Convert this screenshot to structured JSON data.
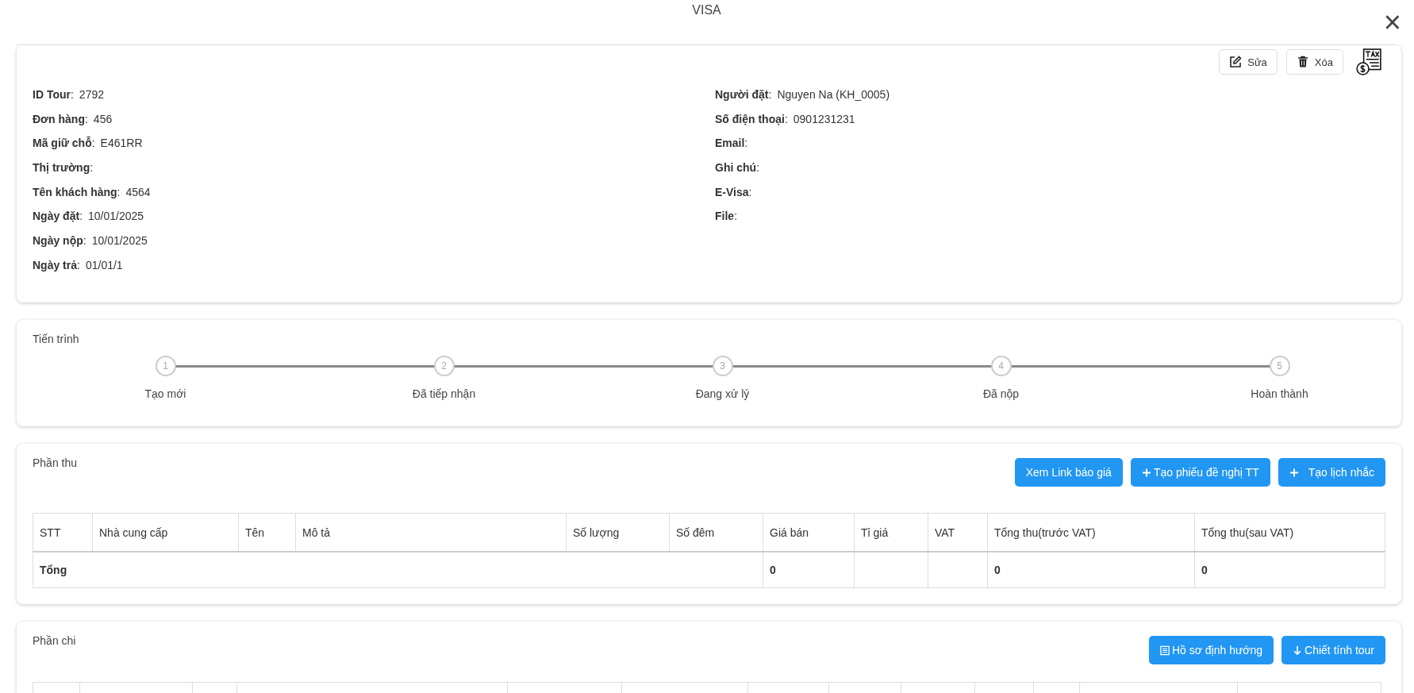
{
  "dialog": {
    "title": "VISA",
    "close": "×"
  },
  "info": {
    "actions": [
      {
        "kind": "edit",
        "label": "Sửa"
      },
      {
        "kind": "delete",
        "label": "Xóa"
      }
    ],
    "left": [
      {
        "label": "**ID Tour**:",
        "value": "2792"
      },
      {
        "label": "**Đơn hàng**:",
        "value": "456"
      },
      {
        "label": "**Mã giữ chỗ**:",
        "value": "E461RR"
      },
      {
        "label": "**Thị trường**:"
      },
      {
        "label": "**Tên khách hàng**:",
        "value": "4564"
      },
      {
        "label": "**Ngày đặt**:",
        "value": "10/01/2025"
      },
      {
        "label": "**Ngày nộp**:",
        "value": "10/01/2025"
      },
      {
        "label": "**Ngày trả**:",
        "value": "01/01/1"
      }
    ],
    "right": [
      {
        "label": "**Người đặt**:",
        "value": "Nguyen Na (KH_0005)"
      },
      {
        "label": "**Số điện thoại**:",
        "value": "0901231231"
      },
      {
        "label": "**Email**:"
      },
      {
        "label": "**Ghi chú**:"
      },
      {
        "label": "**E-Visa**:"
      },
      {
        "label": "**File**:"
      }
    ]
  },
  "progress": {
    "title": "Tiến trình",
    "steps": [
      {
        "number": "1",
        "label": "Tạo mới"
      },
      {
        "number": "2",
        "label": "Đã tiếp nhận"
      },
      {
        "number": "3",
        "label": "Đang xử lý"
      },
      {
        "number": "4",
        "label": "Đã nộp"
      },
      {
        "number": "5",
        "label": "Hoàn thành"
      }
    ]
  },
  "income": {
    "title": "Phần thu",
    "buttons": [
      {
        "kind": "plain",
        "label": "Xem Link báo giá"
      },
      {
        "kind": "plus",
        "label": "Tạo phiếu đề nghị TT"
      },
      {
        "kind": "plus-wide",
        "label": "Tạo lịch nhắc"
      }
    ],
    "table": {
      "columns": [
        "STT",
        "Nhà cung cấp",
        "Tên",
        "Mô tả",
        "Số lượng",
        "Số đêm",
        "Giá bán",
        "Tỉ giá",
        "VAT",
        "Tổng thu(trước VAT)",
        "Tổng thu(sau VAT)"
      ],
      "total": {
        "label": "Tổng",
        "cells": [
          "0",
          "",
          "",
          "0",
          "0"
        ]
      }
    }
  },
  "expense": {
    "title": "Phần chi",
    "buttons": [
      {
        "kind": "doc",
        "label": "Hồ sơ định hướng"
      },
      {
        "kind": "down",
        "label": "Chiết tính tour"
      }
    ]
  }
}
